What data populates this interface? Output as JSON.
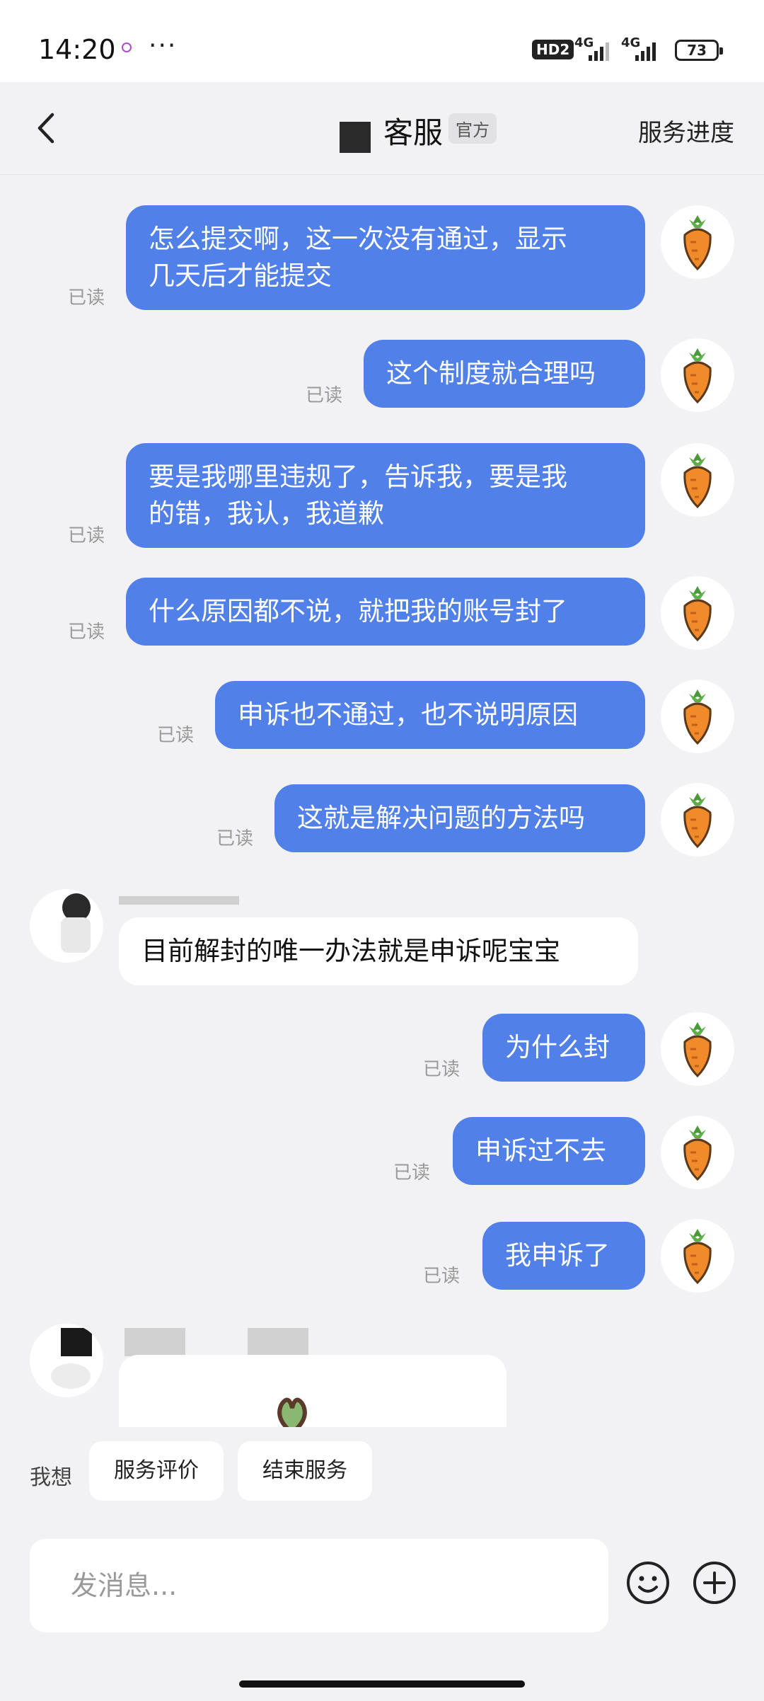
{
  "status": {
    "time": "14:20",
    "more": "···",
    "hd": "HD2",
    "net1": "4G",
    "net2": "4G",
    "battery": "73"
  },
  "nav": {
    "title": "客服",
    "badge": "官方",
    "right_link": "服务进度"
  },
  "messages": [
    {
      "line1": "怎么提交啊，这一次没有通过，显示",
      "line2": "几天后才能提交",
      "read": "已读"
    },
    {
      "text": "这个制度就合理吗",
      "read": "已读"
    },
    {
      "line1": "要是我哪里违规了，告诉我，要是我",
      "line2": "的错，我认，我道歉",
      "read": "已读"
    },
    {
      "text": "什么原因都不说，就把我的账号封了",
      "read": "已读"
    },
    {
      "text": "申诉也不通过，也不说明原因",
      "read": "已读"
    },
    {
      "text": "这就是解决问题的方法吗",
      "read": "已读"
    },
    {
      "text": "目前解封的唯一办法就是申诉呢宝宝"
    },
    {
      "text": "为什么封",
      "read": "已读"
    },
    {
      "text": "申诉过不去",
      "read": "已读"
    },
    {
      "text": "我申诉了",
      "read": "已读"
    }
  ],
  "quick": {
    "label": "我想",
    "chips": [
      "服务评价",
      "结束服务"
    ]
  },
  "input": {
    "placeholder": "发消息..."
  },
  "colors": {
    "bubble": "#5080e8",
    "background": "#f2f2f4"
  }
}
